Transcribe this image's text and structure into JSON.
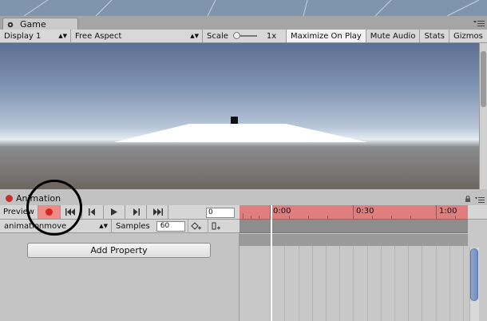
{
  "game_panel": {
    "tab_label": "Game",
    "icons": {
      "tab": "camera-icon",
      "menu": "panel-menu-icon"
    },
    "toolbar": {
      "display": "Display 1",
      "aspect": "Free Aspect",
      "scale_label": "Scale",
      "scale_value": "1x",
      "maximize_on_play": "Maximize On Play",
      "mute_audio": "Mute Audio",
      "stats": "Stats",
      "gizmos": "Gizmos"
    }
  },
  "animation_panel": {
    "tab_label": "Animation",
    "icons": {
      "tab": "record-dot-icon",
      "lock": "lock-icon",
      "menu": "panel-menu-icon"
    },
    "controls": {
      "preview": "Preview",
      "frame": "0"
    },
    "clip": {
      "name": "animationmove",
      "samples_label": "Samples",
      "samples": "60"
    },
    "add_property": "Add Property",
    "timeline": {
      "labels": [
        "0:00",
        "0:30",
        "1:00"
      ]
    }
  },
  "colors": {
    "record_active": "#f08a85",
    "timeline_recording": "#e07e7e",
    "panel_bg": "#c2c2c2",
    "scrollbar_thumb": "#6f8fc2"
  }
}
